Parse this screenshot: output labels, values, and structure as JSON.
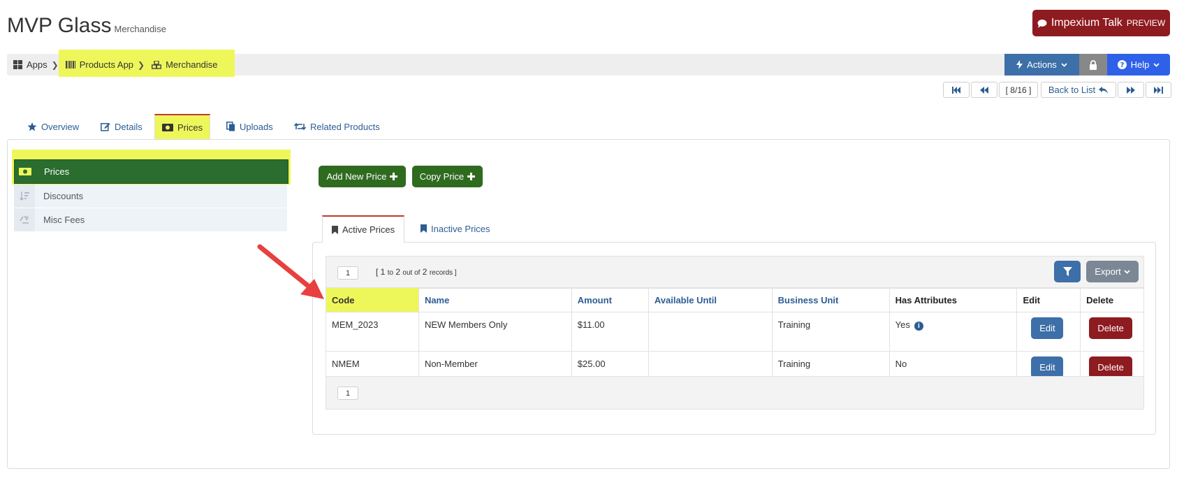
{
  "header": {
    "title": "MVP Glass",
    "subtitle": "Merchandise"
  },
  "talk": {
    "label": "Impexium Talk",
    "badge": "PREVIEW"
  },
  "breadcrumb": [
    {
      "label": "Apps",
      "icon": "grid-icon"
    },
    {
      "label": "Products App",
      "icon": "barcode-icon"
    },
    {
      "label": "Merchandise",
      "icon": "cubes-icon"
    }
  ],
  "toolbar": {
    "actions": "Actions",
    "help": "Help"
  },
  "pager": {
    "counter": "[ 8/16 ]",
    "back": "Back to List"
  },
  "tabs": [
    {
      "label": "Overview",
      "icon": "star-icon"
    },
    {
      "label": "Details",
      "icon": "edit-icon"
    },
    {
      "label": "Prices",
      "icon": "money-icon"
    },
    {
      "label": "Uploads",
      "icon": "copy-icon"
    },
    {
      "label": "Related Products",
      "icon": "retweet-icon"
    }
  ],
  "side_menu": [
    {
      "label": "Prices",
      "icon": "money-icon"
    },
    {
      "label": "Discounts",
      "icon": "sort-icon"
    },
    {
      "label": "Misc Fees",
      "icon": "recycle-icon"
    }
  ],
  "buttons": {
    "add_price": "Add New Price",
    "copy_price": "Copy Price"
  },
  "inner_tabs": {
    "active": "Active Prices",
    "inactive": "Inactive Prices"
  },
  "grid": {
    "page": "1",
    "records_prefix": "[ 1",
    "records_to": "to",
    "records_mid": "2",
    "records_outof": "out of",
    "records_total": "2",
    "records_label": "records ]",
    "export": "Export",
    "columns": [
      "Code",
      "Name",
      "Amount",
      "Available Until",
      "Business Unit",
      "Has Attributes",
      "Edit",
      "Delete"
    ],
    "rows": [
      {
        "code": "MEM_2023",
        "name": "NEW Members Only",
        "amount": "$11.00",
        "available_until": "",
        "business_unit": "Training",
        "has_attributes": "Yes",
        "edit": "Edit",
        "delete": "Delete"
      },
      {
        "code": "NMEM",
        "name": "Non-Member",
        "amount": "$25.00",
        "available_until": "",
        "business_unit": "Training",
        "has_attributes": "No",
        "edit": "Edit",
        "delete": "Delete"
      }
    ]
  },
  "colors": {
    "highlight": "#eef75a",
    "primary": "#3d6fa8",
    "success": "#2f6b1f",
    "danger": "#8e1b1f",
    "arrow": "#e8403f"
  }
}
